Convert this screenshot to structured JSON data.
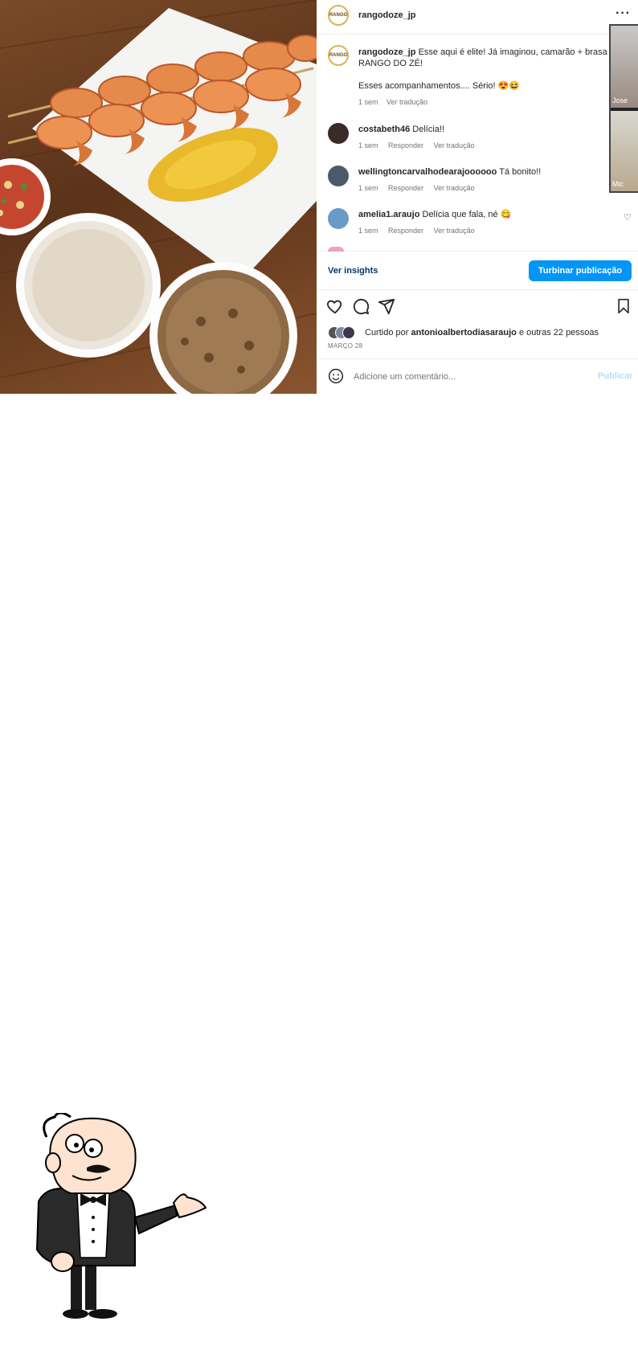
{
  "post": {
    "author": "rangodoze_jp",
    "avatar_text": "RANGO",
    "more_icon": "ellipsis-icon",
    "caption": {
      "user": "rangodoze_jp",
      "line1": "Esse aqui é elite! Já imaginou, camarão + brasa",
      "line2": "RANGO DO ZÉ!",
      "line3": "Esses acompanhamentos.... Sério! 😍😆",
      "time": "1 sem",
      "translate": "Ver tradução"
    },
    "comments": [
      {
        "user": "costabeth46",
        "text": "Delícia!!",
        "time": "1 sem",
        "reply": "Responder",
        "translate": "Ver tradução"
      },
      {
        "user": "wellingtoncarvalhodearajoooooo",
        "text": "Tá bonito!!",
        "time": "1 sem",
        "reply": "Responder",
        "translate": "Ver tradução"
      },
      {
        "user": "amelia1.araujo",
        "text": "Delícia que fala, né 😋",
        "time": "1 sem",
        "reply": "Responder",
        "translate": "Ver tradução"
      }
    ],
    "insights_link": "Ver insights",
    "boost_button": "Turbinar publicação",
    "likes": {
      "prefix": "Curtido por",
      "user": "antonioalbertodiasaraujo",
      "suffix": "e outras 22 pessoas"
    },
    "date": "MARÇO 28",
    "comment_placeholder": "Adicione um comentário...",
    "publish_button": "Publicar"
  },
  "video_overlay": {
    "label_top": "Jose",
    "label_bottom": "Mic"
  },
  "colors": {
    "accent": "#0095f6",
    "publish_disabled": "#b2dffc"
  }
}
